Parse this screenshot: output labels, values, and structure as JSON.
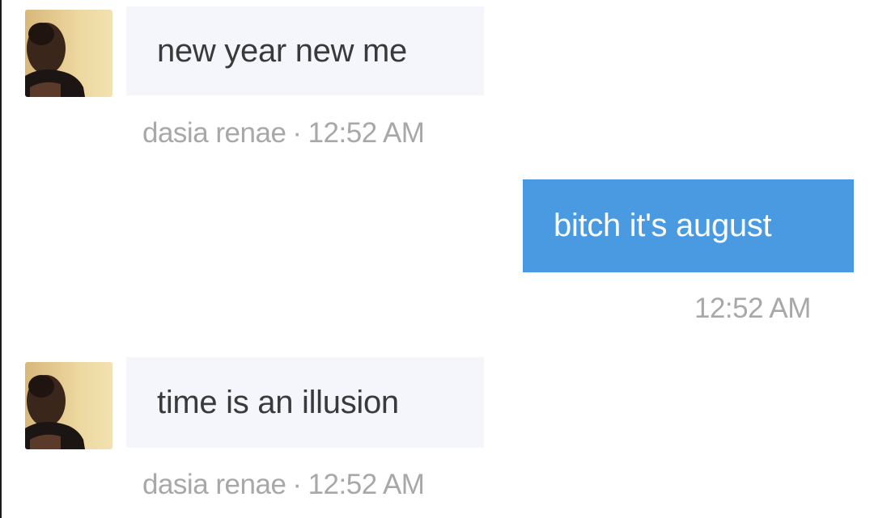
{
  "messages": [
    {
      "direction": "incoming",
      "avatar_icon": "user-avatar",
      "text": "new year new me",
      "sender": "dasia renae",
      "separator": "·",
      "time": "12:52 AM"
    },
    {
      "direction": "outgoing",
      "text": "bitch it's august",
      "time": "12:52 AM"
    },
    {
      "direction": "incoming",
      "avatar_icon": "user-avatar",
      "text": "time is an illusion",
      "sender": "dasia renae",
      "separator": "·",
      "time": "12:52 AM"
    }
  ],
  "colors": {
    "incoming_bubble": "#f4f6fb",
    "outgoing_bubble": "#4a9ae2",
    "meta_text": "#a8a8a8"
  }
}
